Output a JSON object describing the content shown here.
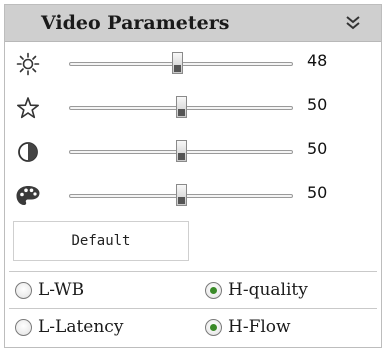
{
  "panel": {
    "title": "Video Parameters",
    "collapse_icon": "double-chevron-down-icon"
  },
  "sliders": [
    {
      "name": "brightness",
      "icon": "sun-icon",
      "value": "48",
      "level": 0.48
    },
    {
      "name": "saturation",
      "icon": "star-icon",
      "value": "50",
      "level": 0.5
    },
    {
      "name": "contrast",
      "icon": "contrast-icon",
      "value": "50",
      "level": 0.5
    },
    {
      "name": "hue",
      "icon": "palette-icon",
      "value": "50",
      "level": 0.5
    }
  ],
  "default_button": {
    "label": "Default"
  },
  "modes": {
    "l_wb": {
      "label": "L-WB",
      "selected": false
    },
    "h_quality": {
      "label": "H-quality",
      "selected": true
    },
    "l_latency": {
      "label": "L-Latency",
      "selected": false
    },
    "h_flow": {
      "label": "H-Flow",
      "selected": true
    }
  },
  "colors": {
    "header_bg": "#cfcfcf",
    "radio_selected": "#3a8a28"
  }
}
